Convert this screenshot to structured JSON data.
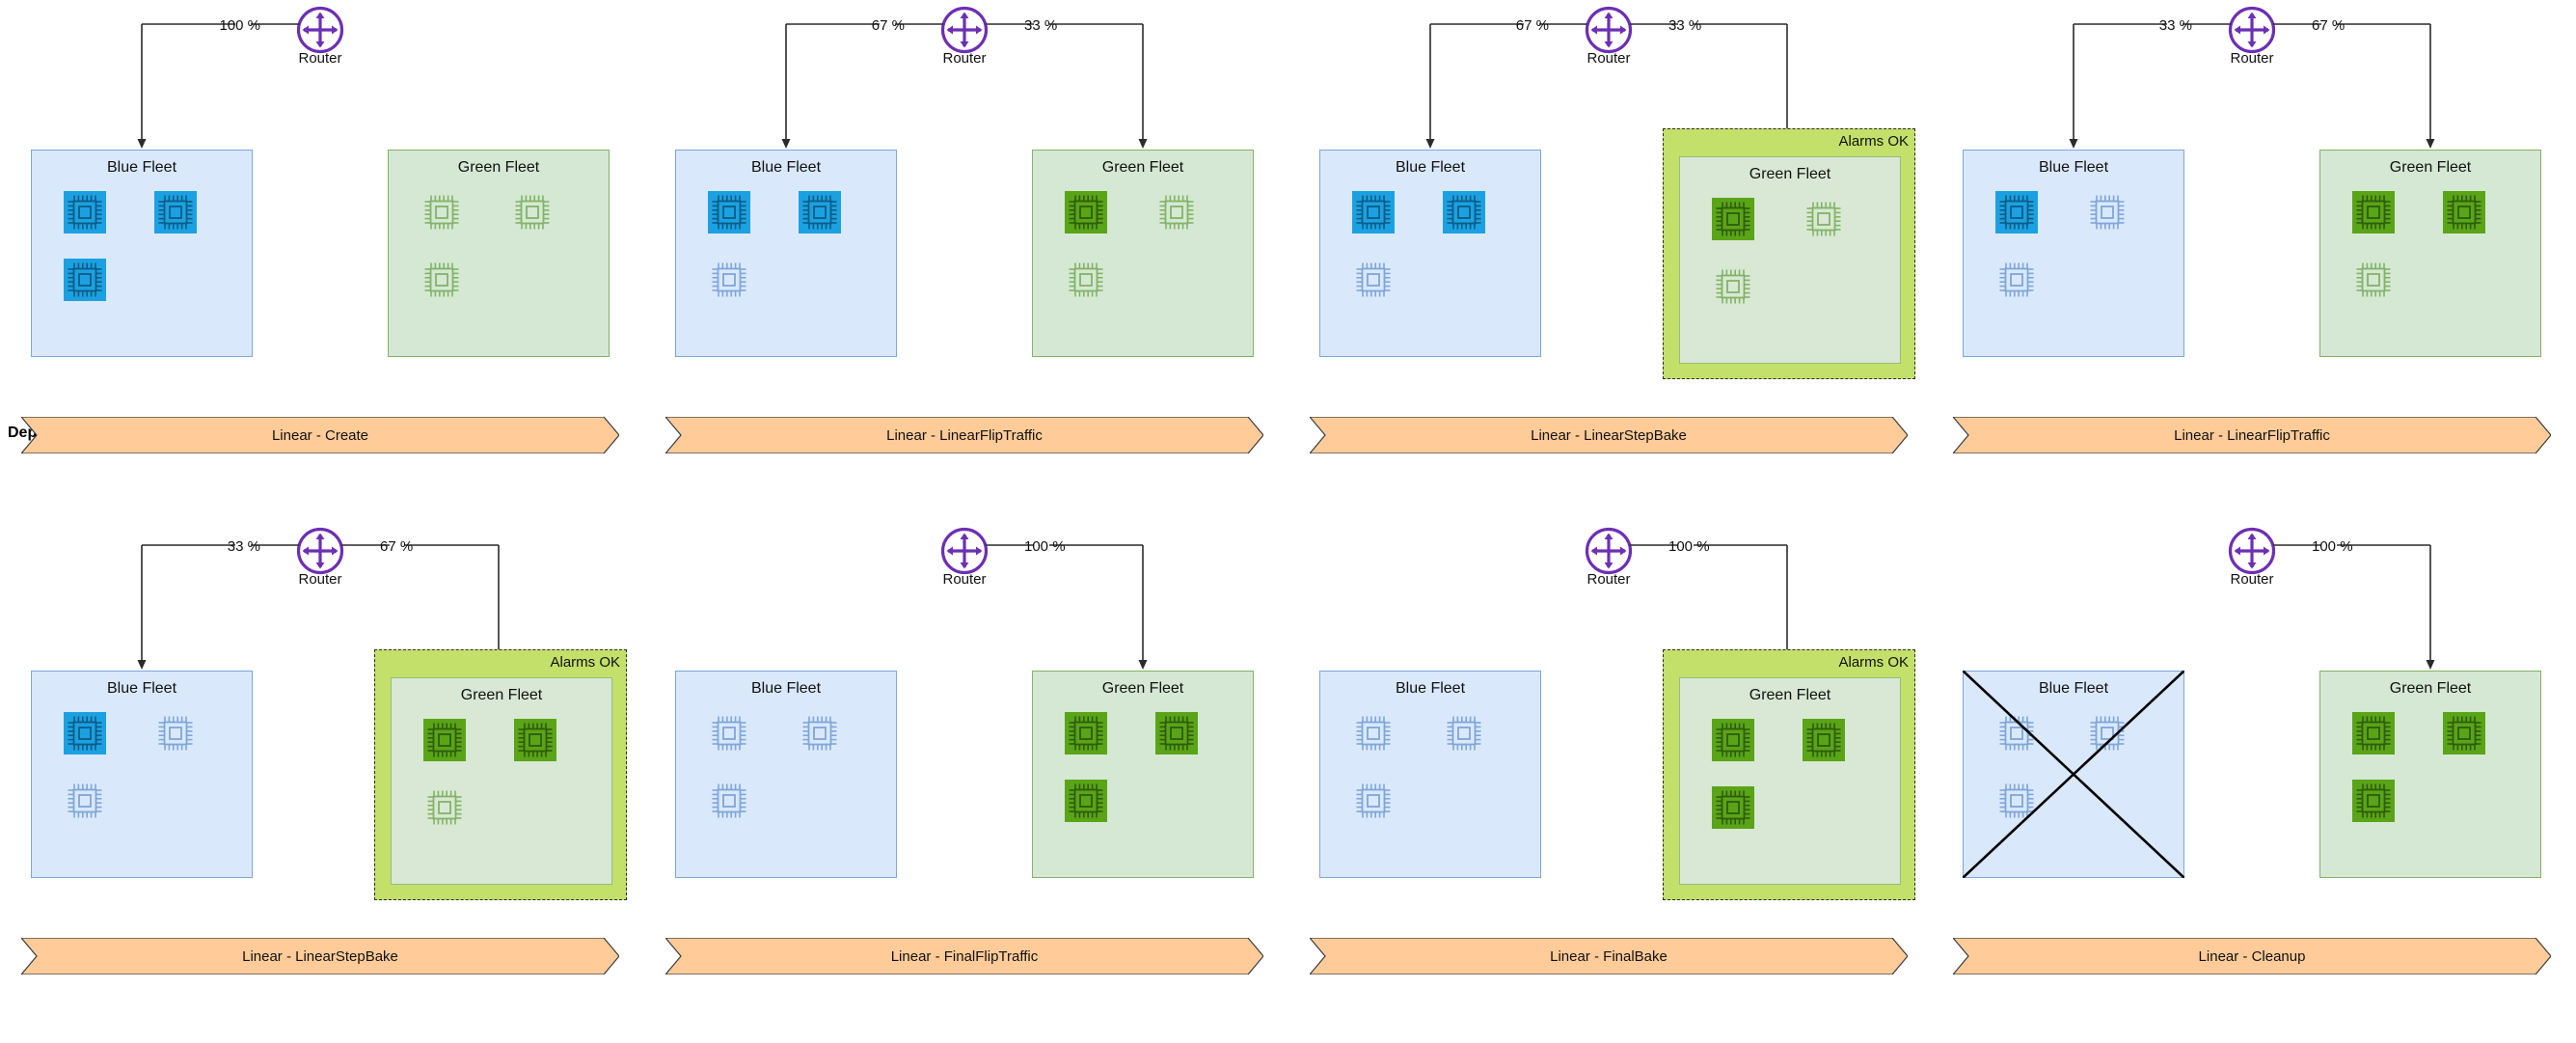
{
  "caption": "Deployment Stages",
  "labels": {
    "router": "Router",
    "blue_fleet": "Blue Fleet",
    "green_fleet": "Green Fleet",
    "alarms_ok": "Alarms OK"
  },
  "colors": {
    "router_stroke": "#6c2fb5",
    "blue_fleet_bg": "#dae8fc",
    "blue_fleet_border": "#7ea6d9",
    "green_fleet_bg": "#d5e8d4",
    "green_fleet_border": "#82b366",
    "chip_blue_active": "#1ba1e2",
    "chip_blue_inactive": "#7ea6d9",
    "chip_green_active": "#5aa417",
    "chip_green_inactive": "#82b366",
    "alarms_bg": "#c3e06a",
    "alarms_border": "#2b2b2b",
    "stage_bg": "#ffcc99",
    "stage_border": "#36393d"
  },
  "panels": [
    {
      "id": "stage-1",
      "stage": "Linear - Create",
      "blue": {
        "title": "Blue Fleet",
        "traffic": "100 %",
        "chips": [
          "active",
          "active",
          "active"
        ],
        "crossed": false
      },
      "green": {
        "title": "Green Fleet",
        "traffic": null,
        "chips": [
          "inactive",
          "inactive",
          "inactive"
        ],
        "alarms": null
      }
    },
    {
      "id": "stage-2",
      "stage": "Linear - LinearFlipTraffic",
      "blue": {
        "title": "Blue Fleet",
        "traffic": "67 %",
        "chips": [
          "active",
          "active",
          "inactive"
        ],
        "crossed": false
      },
      "green": {
        "title": "Green Fleet",
        "traffic": "33 %",
        "chips": [
          "active",
          "inactive",
          "inactive"
        ],
        "alarms": null
      }
    },
    {
      "id": "stage-3",
      "stage": "Linear - LinearStepBake",
      "blue": {
        "title": "Blue Fleet",
        "traffic": "67 %",
        "chips": [
          "active",
          "active",
          "inactive"
        ],
        "crossed": false
      },
      "green": {
        "title": "Green Fleet",
        "traffic": "33 %",
        "chips": [
          "active",
          "inactive",
          "inactive"
        ],
        "alarms": "Alarms OK"
      }
    },
    {
      "id": "stage-4",
      "stage": "Linear - LinearFlipTraffic",
      "blue": {
        "title": "Blue Fleet",
        "traffic": "33 %",
        "chips": [
          "active",
          "inactive",
          "inactive"
        ],
        "crossed": false
      },
      "green": {
        "title": "Green Fleet",
        "traffic": "67 %",
        "chips": [
          "active",
          "active",
          "inactive"
        ],
        "alarms": null
      }
    },
    {
      "id": "stage-5",
      "stage": "Linear - LinearStepBake",
      "blue": {
        "title": "Blue Fleet",
        "traffic": "33 %",
        "chips": [
          "active",
          "inactive",
          "inactive"
        ],
        "crossed": false
      },
      "green": {
        "title": "Green Fleet",
        "traffic": "67 %",
        "chips": [
          "active",
          "active",
          "inactive"
        ],
        "alarms": "Alarms OK"
      }
    },
    {
      "id": "stage-6",
      "stage": "Linear - FinalFlipTraffic",
      "blue": {
        "title": "Blue Fleet",
        "traffic": null,
        "chips": [
          "inactive",
          "inactive",
          "inactive"
        ],
        "crossed": false
      },
      "green": {
        "title": "Green Fleet",
        "traffic": "100 %",
        "chips": [
          "active",
          "active",
          "active"
        ],
        "alarms": null
      }
    },
    {
      "id": "stage-7",
      "stage": "Linear - FinalBake",
      "blue": {
        "title": "Blue Fleet",
        "traffic": null,
        "chips": [
          "inactive",
          "inactive",
          "inactive"
        ],
        "crossed": false
      },
      "green": {
        "title": "Green Fleet",
        "traffic": "100 %",
        "chips": [
          "active",
          "active",
          "active"
        ],
        "alarms": "Alarms OK"
      }
    },
    {
      "id": "stage-8",
      "stage": "Linear - Cleanup",
      "blue": {
        "title": "Blue Fleet",
        "traffic": null,
        "chips": [
          "inactive",
          "inactive",
          "inactive"
        ],
        "crossed": true
      },
      "green": {
        "title": "Green Fleet",
        "traffic": "100 %",
        "chips": [
          "active",
          "active",
          "active"
        ],
        "alarms": null
      }
    }
  ]
}
